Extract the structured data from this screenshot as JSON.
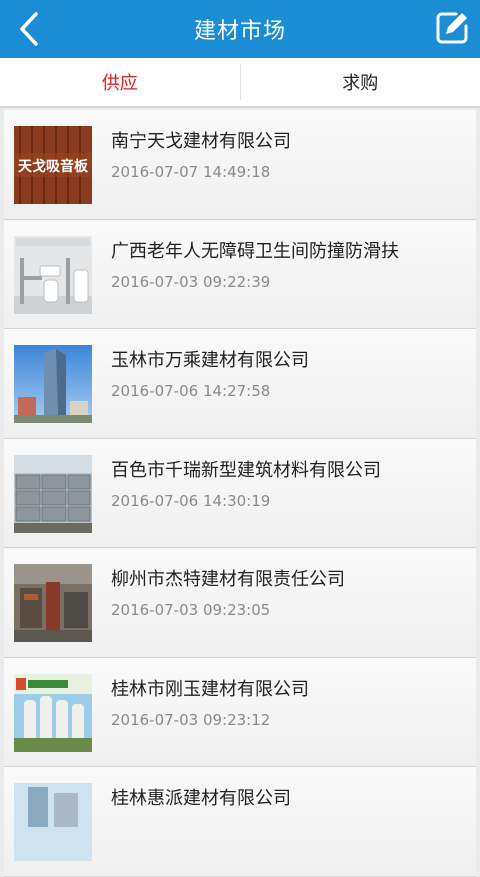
{
  "header": {
    "title": "建材市场",
    "back_icon": "chevron-left-icon",
    "edit_icon": "edit-icon"
  },
  "tabs": [
    {
      "label": "供应",
      "active": true
    },
    {
      "label": "求购",
      "active": false
    }
  ],
  "colors": {
    "header_bg": "#1a8dd4",
    "active_tab": "#e0201c"
  },
  "items": [
    {
      "name": "南宁天戈建材有限公司",
      "date": "2016-07-07 14:49:18",
      "thumb_text": "天戈吸音板"
    },
    {
      "name": "广西老年人无障碍卫生间防撞防滑扶",
      "date": "2016-07-03 09:22:39"
    },
    {
      "name": "玉林市万乘建材有限公司",
      "date": "2016-07-06 14:27:58"
    },
    {
      "name": "百色市千瑞新型建筑材料有限公司",
      "date": "2016-07-06 14:30:19"
    },
    {
      "name": "柳州市杰特建材有限责任公司",
      "date": "2016-07-03 09:23:05"
    },
    {
      "name": "桂林市刚玉建材有限公司",
      "date": "2016-07-03 09:23:12"
    },
    {
      "name": "桂林惠派建材有限公司",
      "date": ""
    }
  ]
}
